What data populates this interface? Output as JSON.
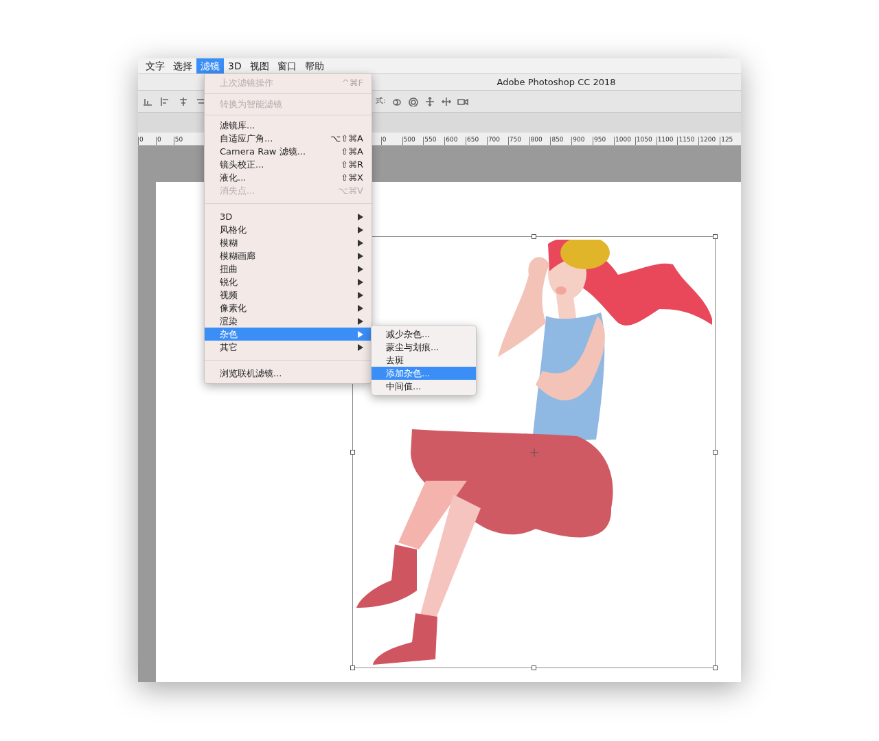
{
  "menu_bar": [
    {
      "label": "文字",
      "selected": false
    },
    {
      "label": "选择",
      "selected": false
    },
    {
      "label": "滤镜",
      "selected": true
    },
    {
      "label": "3D",
      "selected": false
    },
    {
      "label": "视图",
      "selected": false
    },
    {
      "label": "窗口",
      "selected": false
    },
    {
      "label": "帮助",
      "selected": false
    }
  ],
  "window": {
    "title": "Adobe Photoshop CC 2018"
  },
  "options_bar": {
    "mode_label": "式:"
  },
  "ruler": {
    "labels": [
      "0",
      "0",
      "50",
      "0",
      "500",
      "550",
      "600",
      "650",
      "700",
      "750",
      "800",
      "850",
      "900",
      "950",
      "1000",
      "1050",
      "1100",
      "1150",
      "1200",
      "125"
    ]
  },
  "filter_menu": {
    "sections": [
      [
        {
          "kind": "command",
          "label": "上次滤镜操作",
          "shortcut": "^⌘F",
          "disabled": true,
          "selected": false
        }
      ],
      [
        {
          "kind": "command",
          "label": "转换为智能滤镜",
          "disabled": true,
          "selected": false
        }
      ],
      [
        {
          "kind": "command",
          "label": "滤镜库...",
          "disabled": false,
          "selected": false
        },
        {
          "kind": "command",
          "label": "自适应广角...",
          "shortcut": "⌥⇧⌘A",
          "disabled": false,
          "selected": false
        },
        {
          "kind": "command",
          "label": "Camera Raw 滤镜...",
          "shortcut": "⇧⌘A",
          "disabled": false,
          "selected": false
        },
        {
          "kind": "command",
          "label": "镜头校正...",
          "shortcut": "⇧⌘R",
          "disabled": false,
          "selected": false
        },
        {
          "kind": "command",
          "label": "液化...",
          "shortcut": "⇧⌘X",
          "disabled": false,
          "selected": false
        },
        {
          "kind": "command",
          "label": "消失点...",
          "shortcut": "⌥⌘V",
          "disabled": true,
          "selected": false
        }
      ],
      [
        {
          "kind": "submenu",
          "label": "3D",
          "disabled": false,
          "selected": false
        },
        {
          "kind": "submenu",
          "label": "风格化",
          "disabled": false,
          "selected": false
        },
        {
          "kind": "submenu",
          "label": "模糊",
          "disabled": false,
          "selected": false
        },
        {
          "kind": "submenu",
          "label": "模糊画廊",
          "disabled": false,
          "selected": false
        },
        {
          "kind": "submenu",
          "label": "扭曲",
          "disabled": false,
          "selected": false
        },
        {
          "kind": "submenu",
          "label": "锐化",
          "disabled": false,
          "selected": false
        },
        {
          "kind": "submenu",
          "label": "视频",
          "disabled": false,
          "selected": false
        },
        {
          "kind": "submenu",
          "label": "像素化",
          "disabled": false,
          "selected": false
        },
        {
          "kind": "submenu",
          "label": "渲染",
          "disabled": false,
          "selected": false
        },
        {
          "kind": "submenu",
          "label": "杂色",
          "disabled": false,
          "selected": true
        },
        {
          "kind": "submenu",
          "label": "其它",
          "disabled": false,
          "selected": false
        }
      ],
      [
        {
          "kind": "command",
          "label": "浏览联机滤镜...",
          "disabled": false,
          "selected": false
        }
      ]
    ]
  },
  "noise_submenu": {
    "items": [
      {
        "label": "减少杂色...",
        "selected": false
      },
      {
        "label": "蒙尘与划痕...",
        "selected": false
      },
      {
        "label": "去斑",
        "selected": false
      },
      {
        "label": "添加杂色...",
        "selected": true
      },
      {
        "label": "中间值...",
        "selected": false
      }
    ]
  }
}
